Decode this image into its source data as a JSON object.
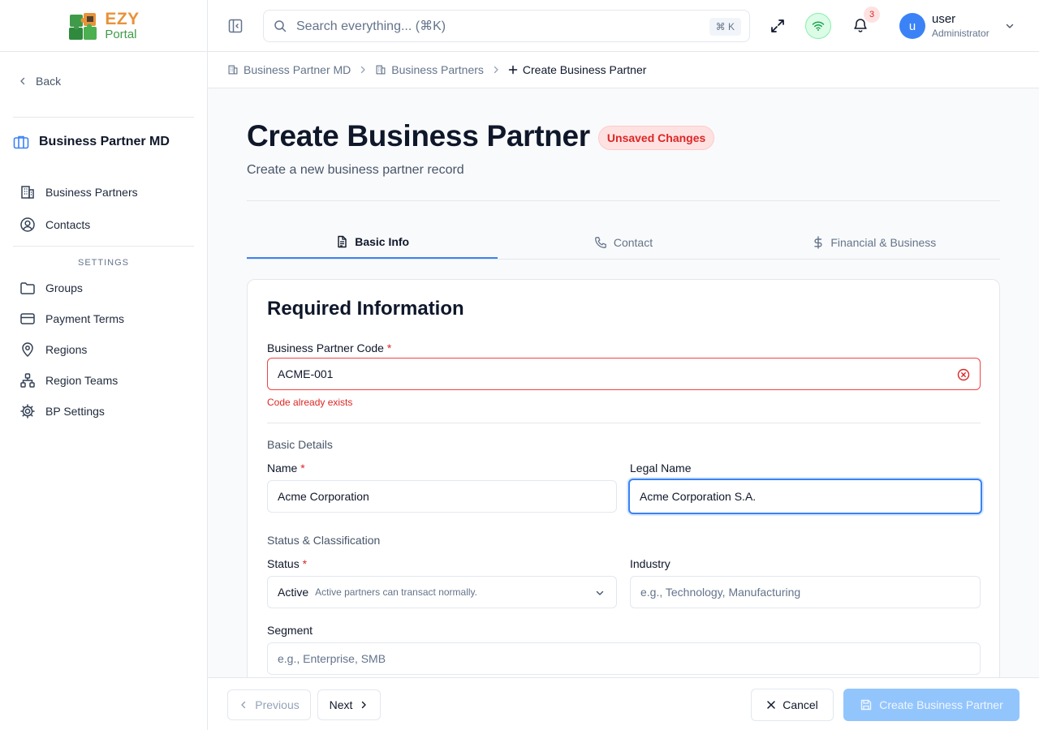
{
  "brand": {
    "name": "EZY",
    "sub": "Portal"
  },
  "sidebar": {
    "back_label": "Back",
    "module_title": "Business Partner MD",
    "items": [
      {
        "label": "Business Partners",
        "icon": "building-icon"
      },
      {
        "label": "Contacts",
        "icon": "user-circle-icon"
      }
    ],
    "settings_heading": "SETTINGS",
    "settings_items": [
      {
        "label": "Groups",
        "icon": "folder-icon"
      },
      {
        "label": "Payment Terms",
        "icon": "credit-card-icon"
      },
      {
        "label": "Regions",
        "icon": "map-pin-icon"
      },
      {
        "label": "Region Teams",
        "icon": "network-icon"
      },
      {
        "label": "BP Settings",
        "icon": "gear-icon"
      }
    ]
  },
  "topbar": {
    "search_placeholder": "Search everything... (⌘K)",
    "search_kbd": "⌘ K",
    "notification_count": "3",
    "user": {
      "initial": "u",
      "name": "user",
      "role": "Administrator"
    }
  },
  "breadcrumb": {
    "items": [
      "Business Partner MD",
      "Business Partners"
    ],
    "current": "Create Business Partner"
  },
  "page": {
    "title": "Create Business Partner",
    "status_badge": "Unsaved Changes",
    "subtitle": "Create a new business partner record"
  },
  "tabs": [
    {
      "label": "Basic Info",
      "active": true
    },
    {
      "label": "Contact",
      "active": false
    },
    {
      "label": "Financial & Business",
      "active": false
    }
  ],
  "form": {
    "section_title": "Required Information",
    "code": {
      "label": "Business Partner Code",
      "required": "*",
      "value": "ACME-001",
      "error": "Code already exists"
    },
    "basic_details_heading": "Basic Details",
    "name": {
      "label": "Name",
      "required": "*",
      "value": "Acme Corporation"
    },
    "legal_name": {
      "label": "Legal Name",
      "value": "Acme Corporation S.A."
    },
    "status_heading": "Status & Classification",
    "status": {
      "label": "Status",
      "required": "*",
      "value": "Active",
      "hint": "Active partners can transact normally."
    },
    "industry": {
      "label": "Industry",
      "placeholder": "e.g., Technology, Manufacturing"
    },
    "segment": {
      "label": "Segment",
      "placeholder": "e.g., Enterprise, SMB"
    }
  },
  "footer": {
    "previous_label": "Previous",
    "next_label": "Next",
    "cancel_label": "Cancel",
    "submit_label": "Create Business Partner"
  },
  "colors": {
    "accent": "#3b82f6",
    "error": "#dc2626",
    "brand_orange": "#e8923a",
    "brand_green": "#3f9b4a"
  }
}
